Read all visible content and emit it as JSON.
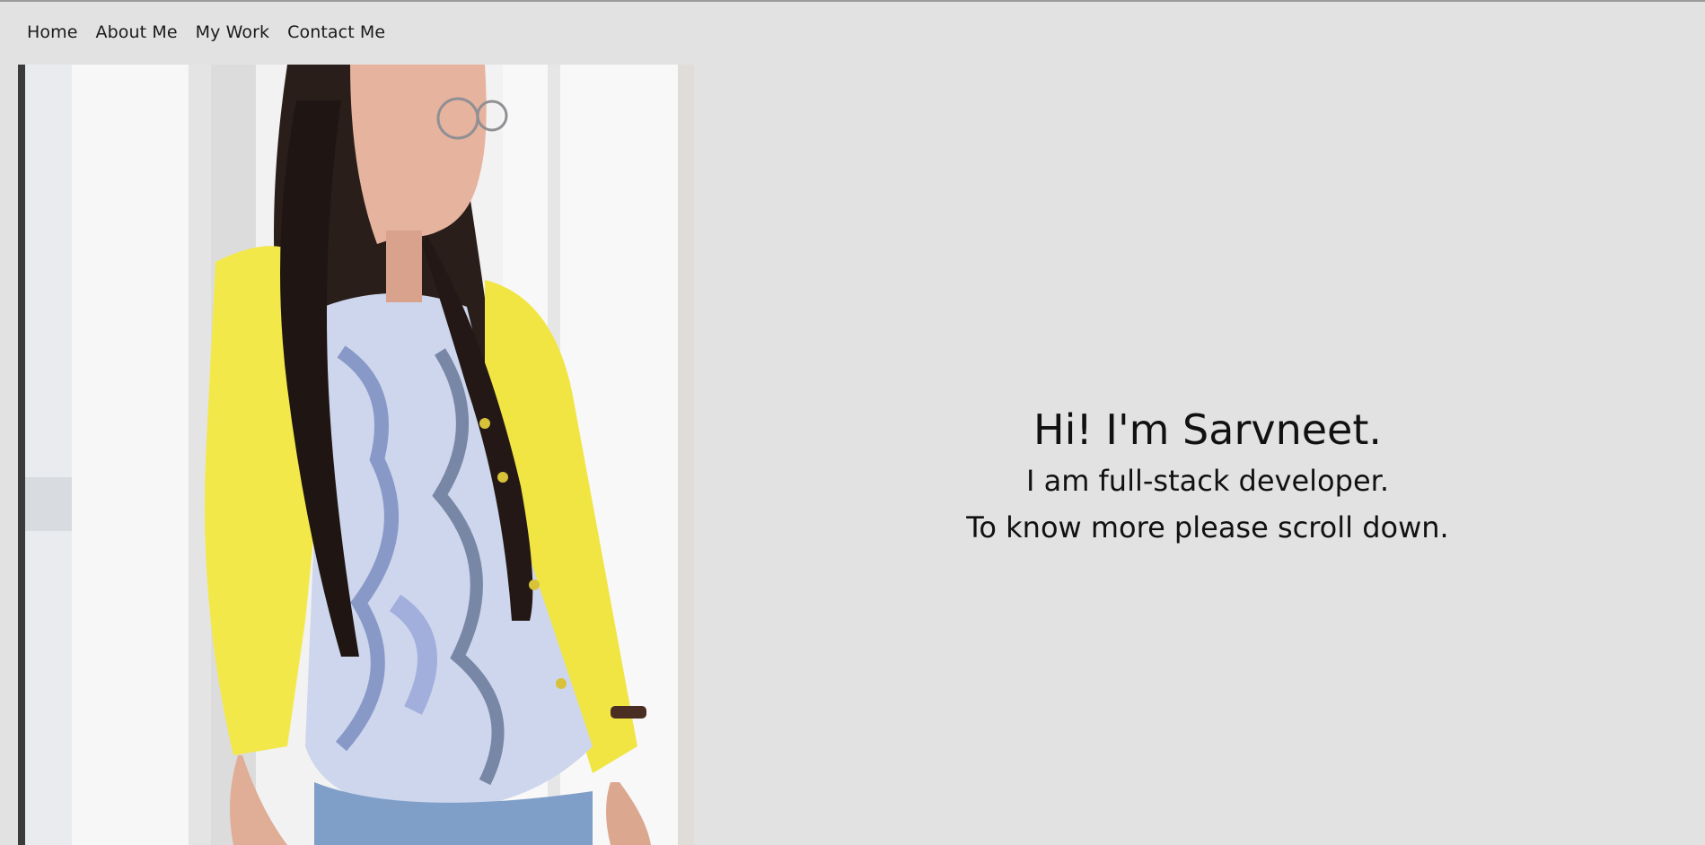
{
  "nav": {
    "items": [
      {
        "label": "Home"
      },
      {
        "label": "About Me"
      },
      {
        "label": "My Work"
      },
      {
        "label": "Contact Me"
      }
    ]
  },
  "hero": {
    "title": "Hi! I'm Sarvneet.",
    "line1": "I am full-stack developer.",
    "line2": "To know more please scroll down."
  },
  "colors": {
    "background": "#e2e2e2",
    "text": "#111111",
    "cardigan": "#f3e84a",
    "hair": "#2a1e1a"
  }
}
